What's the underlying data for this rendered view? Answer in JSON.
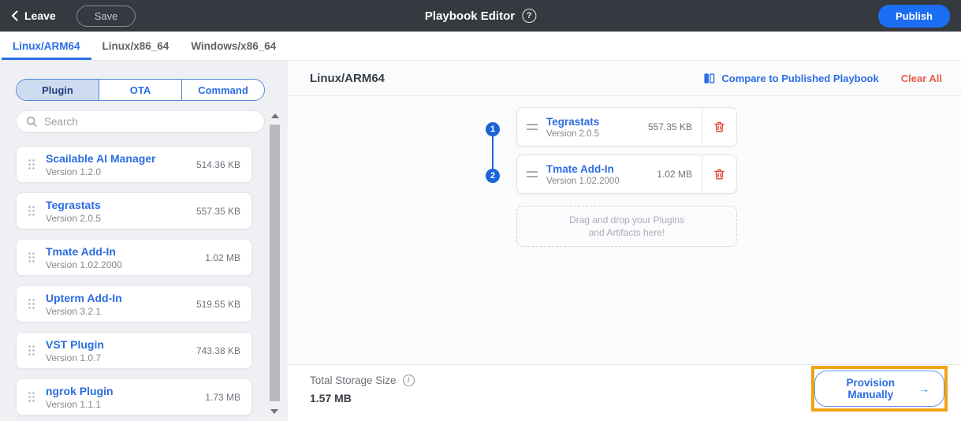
{
  "topbar": {
    "leave_label": "Leave",
    "save_label": "Save",
    "title": "Playbook Editor",
    "publish_label": "Publish"
  },
  "tabs": [
    {
      "label": "Linux/ARM64",
      "active": true
    },
    {
      "label": "Linux/x86_64",
      "active": false
    },
    {
      "label": "Windows/x86_64",
      "active": false
    }
  ],
  "sidebar": {
    "segments": [
      {
        "label": "Plugin",
        "selected": true
      },
      {
        "label": "OTA",
        "selected": false
      },
      {
        "label": "Command",
        "selected": false
      }
    ],
    "search_placeholder": "Search",
    "plugins": [
      {
        "name": "Scailable AI Manager",
        "version": "Version 1.2.0",
        "size": "514.36 KB"
      },
      {
        "name": "Tegrastats",
        "version": "Version 2.0.5",
        "size": "557.35 KB"
      },
      {
        "name": "Tmate Add-In",
        "version": "Version 1.02.2000",
        "size": "1.02 MB"
      },
      {
        "name": "Upterm Add-In",
        "version": "Version 3.2.1",
        "size": "519.55 KB"
      },
      {
        "name": "VST Plugin",
        "version": "Version 1.0.7",
        "size": "743.38 KB"
      },
      {
        "name": "ngrok Plugin",
        "version": "Version 1.1.1",
        "size": "1.73 MB"
      }
    ]
  },
  "main": {
    "title": "Linux/ARM64",
    "compare_label": "Compare to Published Playbook",
    "clear_all_label": "Clear All",
    "items": [
      {
        "step": "1",
        "name": "Tegrastats",
        "version": "Version 2.0.5",
        "size": "557.35 KB"
      },
      {
        "step": "2",
        "name": "Tmate Add-In",
        "version": "Version 1.02.2000",
        "size": "1.02 MB"
      }
    ],
    "dropzone_line1": "Drag and drop your Plugins",
    "dropzone_line2": "and Artifacts here!",
    "footer": {
      "total_label": "Total Storage Size",
      "total_value": "1.57 MB",
      "provision_label": "Provision Manually",
      "provision_arrow": "→"
    }
  },
  "colors": {
    "topbar_dark": "#353a41",
    "accent_blue": "#2b6de4",
    "step_blue": "#1b63d6",
    "publish_blue": "#1b6ef3",
    "danger_red": "#e2473b",
    "clear_all_red": "#e8584a",
    "highlight_orange": "#f0a413",
    "sidebar_gray": "#eef0f4"
  }
}
